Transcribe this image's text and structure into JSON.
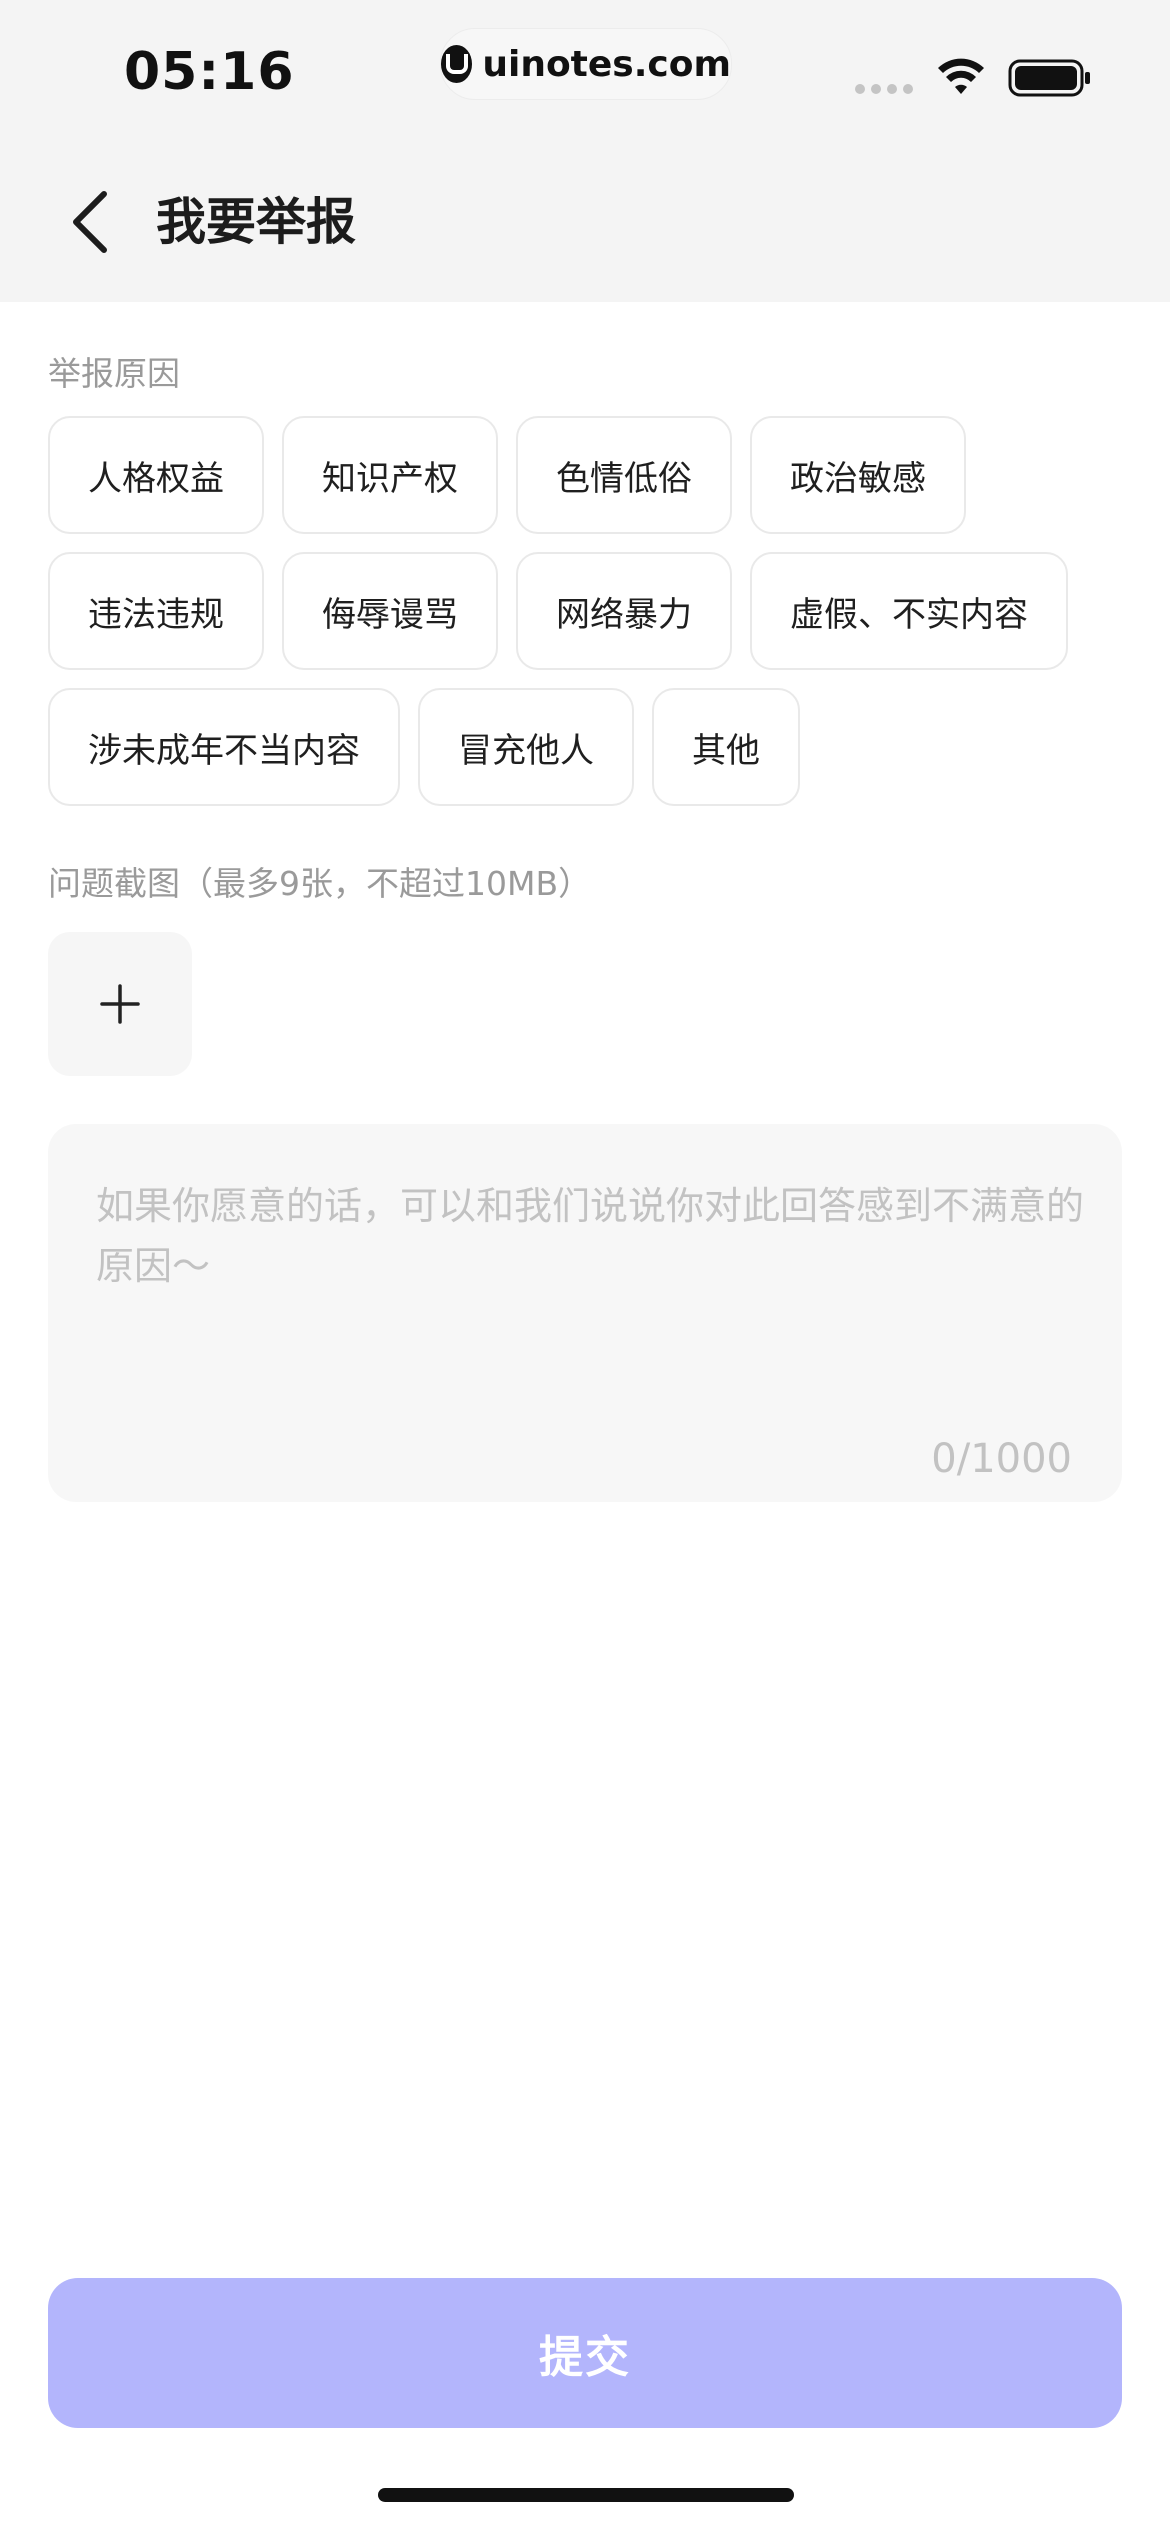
{
  "status_bar": {
    "time": "05:16",
    "url": "uinotes.com",
    "logo_icon": "uinotes-logo-icon",
    "wifi_icon": "wifi-icon",
    "battery_icon": "battery-icon"
  },
  "nav": {
    "back_icon": "chevron-left-icon",
    "title": "我要举报"
  },
  "reason_section": {
    "label": "举报原因",
    "rows": [
      [
        "人格权益",
        "知识产权",
        "色情低俗",
        "政治敏感"
      ],
      [
        "违法违规",
        "侮辱谩骂",
        "网络暴力",
        "虚假、不实内容"
      ],
      [
        "涉未成年不当内容",
        "冒充他人",
        "其他"
      ]
    ]
  },
  "screenshot_section": {
    "label": "问题截图（最多9张，不超过10MB）",
    "add_icon": "plus-icon"
  },
  "feedback": {
    "placeholder": "如果你愿意的话，可以和我们说说你对此回答感到不满意的原因～",
    "counter": "0/1000"
  },
  "submit": {
    "label": "提交"
  },
  "colors": {
    "header_bg": "#f4f4f4",
    "submit_bg": "#b3b5fc",
    "placeholder": "#c2c2c2",
    "tag_border": "#e9e9e9"
  }
}
